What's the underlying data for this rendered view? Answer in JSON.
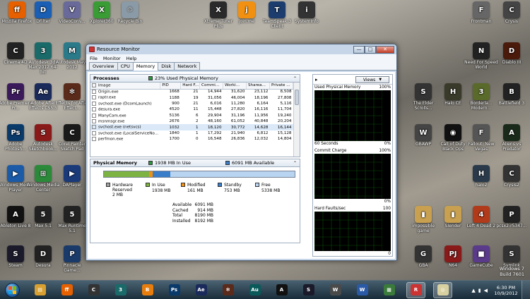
{
  "desktop_icons": [
    {
      "id": "firefox",
      "label": "Mozilla Firefox",
      "color": "#e66000",
      "glyph": "ff"
    },
    {
      "id": "dfilter",
      "label": "DFilter",
      "color": "#1a5fb4",
      "glyph": "D"
    },
    {
      "id": "videoconv",
      "label": "VideoConv...",
      "color": "#6a6a9a",
      "glyph": "V"
    },
    {
      "id": "xplorer",
      "label": "Xplorer360",
      "color": "#3a9c35",
      "glyph": "X"
    },
    {
      "id": "recyclebin",
      "label": "Recycle Bin",
      "color": "#8a9aa6",
      "glyph": "♲"
    },
    {
      "id": "xtreme",
      "label": "Xtreme Tuner Plus",
      "color": "#2a2a2a",
      "glyph": "X"
    },
    {
      "id": "joinme",
      "label": "join.me",
      "color": "#f29111",
      "glyph": "j"
    },
    {
      "id": "teamspeak",
      "label": "TeamSpeak 3 Client",
      "color": "#1d3d6e",
      "glyph": "T"
    },
    {
      "id": "sysinfo",
      "label": "SystemInfo",
      "color": "#333",
      "glyph": "i"
    },
    {
      "id": "frontman",
      "label": "Frontman",
      "color": "#666",
      "glyph": "F"
    },
    {
      "id": "crysis",
      "label": "Crysis",
      "color": "#444",
      "glyph": "C"
    },
    {
      "id": "cinema",
      "label": "Cinema 4D",
      "color": "#222",
      "glyph": "C"
    },
    {
      "id": "max",
      "label": "Autodesk 3ds Max 2012 64-bit",
      "color": "#1a6a6a",
      "glyph": "3"
    },
    {
      "id": "maya",
      "label": "Autodesk Maya 2012",
      "color": "#2a7a8a",
      "glyph": "M"
    },
    {
      "id": "premiere",
      "label": "Adobe Premiere Pr...",
      "color": "#3a1a5a",
      "glyph": "Pr"
    },
    {
      "id": "aftereffects",
      "label": "Adobe After Effects CS5.5",
      "color": "#1a2a5a",
      "glyph": "Ae"
    },
    {
      "id": "aeffects2",
      "label": "Effects for After Effect...",
      "color": "#5a2a1a",
      "glyph": "✻"
    },
    {
      "id": "photoshop",
      "label": "Adobe Photosh...",
      "color": "#0a3a6a",
      "glyph": "Ps"
    },
    {
      "id": "sketchbook",
      "label": "Autodesk Sketchbook...",
      "color": "#8a1a1a",
      "glyph": "S"
    },
    {
      "id": "corelpainter",
      "label": "Corel Painter Sketch Pad",
      "color": "#1a1a1a",
      "glyph": "C"
    },
    {
      "id": "wmp",
      "label": "Windows Media Player",
      "color": "#1a5aa6",
      "glyph": "▶"
    },
    {
      "id": "wmc",
      "label": "Windows Media Center",
      "color": "#2a8a3a",
      "glyph": "⊞"
    },
    {
      "id": "daplayer",
      "label": "DAPlayer",
      "color": "#1a3a7a",
      "glyph": "▶"
    },
    {
      "id": "ableton",
      "label": "Ableton Live 8",
      "color": "#111",
      "glyph": "A"
    },
    {
      "id": "max5",
      "label": "Max 5.1",
      "color": "#222",
      "glyph": "5"
    },
    {
      "id": "maxruntime",
      "label": "Max Runtime 5.1",
      "color": "#222",
      "glyph": "5"
    },
    {
      "id": "steam",
      "label": "Steam",
      "color": "#1a1a2a",
      "glyph": "S"
    },
    {
      "id": "desura",
      "label": "Desura",
      "color": "#222",
      "glyph": "D"
    },
    {
      "id": "pinnacle",
      "label": "Pinnacle Game...",
      "color": "#1a3a6a",
      "glyph": "P"
    },
    {
      "id": "nfs",
      "label": "Need For Speed World",
      "color": "#222",
      "glyph": "N"
    },
    {
      "id": "diablo",
      "label": "Diablo III",
      "color": "#4a1a0a",
      "glyph": "D"
    },
    {
      "id": "elderscrolls",
      "label": "The Elder Scrolls...",
      "color": "#333",
      "glyph": "S"
    },
    {
      "id": "halo",
      "label": "Halo CE",
      "color": "#3a3a2a",
      "glyph": "H"
    },
    {
      "id": "borderlands",
      "label": "Borderla... Modern...",
      "color": "#5a6a2a",
      "glyph": "3"
    },
    {
      "id": "battlefield",
      "label": "Battlefield 3",
      "color": "#222",
      "glyph": "B"
    },
    {
      "id": "gbawp",
      "label": "GBAWP",
      "color": "#444",
      "glyph": "W"
    },
    {
      "id": "codblackops",
      "label": "Call of Duty Black Ops",
      "color": "#111",
      "glyph": "◉"
    },
    {
      "id": "falloutnv",
      "label": "Fallout: New Vegas",
      "color": "#555",
      "glyph": "F"
    },
    {
      "id": "alienspred",
      "label": "Aliens vs Predator",
      "color": "#1a2a1a",
      "glyph": "A"
    },
    {
      "id": "halo2",
      "label": "halo2",
      "color": "#2a3a4a",
      "glyph": "H"
    },
    {
      "id": "crysis2",
      "label": "Crysis2",
      "color": "#333",
      "glyph": "C"
    },
    {
      "id": "impossible",
      "label": "impossible game",
      "color": "#c8a050",
      "glyph": "▮"
    },
    {
      "id": "slender",
      "label": "Slender",
      "color": "#c8a050",
      "glyph": "▮"
    },
    {
      "id": "l4d2",
      "label": "Left 4 Dead 2",
      "color": "#b03a1a",
      "glyph": "4"
    },
    {
      "id": "pcsx2",
      "label": "pcsx2-r5347...",
      "color": "#222",
      "glyph": "P"
    },
    {
      "id": "gba",
      "label": "GBA",
      "color": "#333",
      "glyph": "G"
    },
    {
      "id": "n64",
      "label": "N64",
      "color": "#8a1a1a",
      "glyph": "PJ"
    },
    {
      "id": "gamecube",
      "label": "GameCube",
      "color": "#5a3a8a",
      "glyph": "■"
    },
    {
      "id": "symlink",
      "label": "Symlink",
      "color": "#333",
      "glyph": "S"
    }
  ],
  "window": {
    "title": "Resource Monitor",
    "menu": [
      "File",
      "Monitor",
      "Help"
    ],
    "tabs": [
      "Overview",
      "CPU",
      "Memory",
      "Disk",
      "Network"
    ],
    "active_tab": "Memory",
    "win_buttons": {
      "minimize": "—",
      "maximize": "□",
      "close": "✕"
    }
  },
  "processes": {
    "title": "Processes",
    "summary": "23% Used Physical Memory",
    "columns": [
      "Image",
      "PID",
      "Hard F...",
      "Commi...",
      "Worki...",
      "Sharea...",
      "Private ..."
    ],
    "rows": [
      [
        "Origin.exe",
        "1668",
        "21",
        "14,944",
        "31,620",
        "23,112",
        "8,508"
      ],
      [
        "raptr.exe",
        "1188",
        "19",
        "31,056",
        "46,004",
        "18,196",
        "27,808"
      ],
      [
        "svchost.exe (DcomLaunch)",
        "900",
        "21",
        "6,016",
        "11,280",
        "6,164",
        "5,116"
      ],
      [
        "desura.exe",
        "4520",
        "11",
        "15,448",
        "27,820",
        "16,116",
        "11,704"
      ],
      [
        "ManyCam.exe",
        "5136",
        "6",
        "29,904",
        "31,196",
        "11,956",
        "19,240"
      ],
      [
        "msnmsgr.exe",
        "2676",
        "2",
        "48,160",
        "61,052",
        "40,848",
        "20,204"
      ],
      [
        "svchost.exe (netsvcs)",
        "1032",
        "1",
        "18,120",
        "30,772",
        "14,628",
        "16,144"
      ],
      [
        "svchost.exe (LocalServiceNo...",
        "1840",
        "1",
        "17,292",
        "21,940",
        "6,812",
        "15,128"
      ],
      [
        "perfmon.exe",
        "1700",
        "0",
        "16,548",
        "26,836",
        "12,032",
        "14,804"
      ]
    ],
    "selected_row": 6
  },
  "physical_memory": {
    "title": "Physical Memory",
    "in_use_head": "1938 MB In Use",
    "available_head": "6091 MB Available",
    "legend": [
      {
        "label": "Hardware Reserved",
        "value": "2 MB",
        "color": "#a0a0a0"
      },
      {
        "label": "In Use",
        "value": "1938 MB",
        "color": "#7cb342"
      },
      {
        "label": "Modified",
        "value": "161 MB",
        "color": "#f29111"
      },
      {
        "label": "Standby",
        "value": "753 MB",
        "color": "#3a7dc9"
      },
      {
        "label": "Free",
        "value": "5338 MB",
        "color": "#b8d4f0"
      }
    ],
    "bar_fractions": [
      0.0003,
      0.236,
      0.02,
      0.092,
      0.652
    ],
    "stats": [
      {
        "label": "Available",
        "value": "6091 MB"
      },
      {
        "label": "Cached",
        "value": "914 MB"
      },
      {
        "label": "Total",
        "value": "8190 MB"
      },
      {
        "label": "Installed",
        "value": "8192 MB"
      }
    ]
  },
  "graphs": {
    "views_label": "Views",
    "items": [
      {
        "title": "Used Physical Memory",
        "top": "100%",
        "bottom_left": "60 Seconds",
        "bottom_right": "0%"
      },
      {
        "title": "Commit Charge",
        "top": "100%",
        "bottom_left": "",
        "bottom_right": "0%"
      },
      {
        "title": "Hard Faults/sec",
        "top": "100",
        "bottom_left": "",
        "bottom_right": "0"
      }
    ]
  },
  "taskbar": {
    "apps": [
      {
        "id": "explorer",
        "color": "#d8a030",
        "glyph": "▤"
      },
      {
        "id": "firefox",
        "color": "#e66000",
        "glyph": "ff"
      },
      {
        "id": "cinema",
        "color": "#333",
        "glyph": "C"
      },
      {
        "id": "3dsmax",
        "color": "#1a6a6a",
        "glyph": "3"
      },
      {
        "id": "blender",
        "color": "#e87d0d",
        "glyph": "B"
      },
      {
        "id": "photoshop",
        "color": "#0a3a6a",
        "glyph": "Ps"
      },
      {
        "id": "aftereffects",
        "color": "#1a2a5a",
        "glyph": "Ae"
      },
      {
        "id": "tool",
        "color": "#5a2a1a",
        "glyph": "✻"
      },
      {
        "id": "audition",
        "color": "#0a5a5a",
        "glyph": "Au"
      },
      {
        "id": "ableton",
        "color": "#111",
        "glyph": "A"
      },
      {
        "id": "steam",
        "color": "#1a1a2a",
        "glyph": "S"
      },
      {
        "id": "wolf",
        "color": "#4a4a4a",
        "glyph": "W"
      },
      {
        "id": "word",
        "color": "#2a5aa6",
        "glyph": "W"
      },
      {
        "id": "paint",
        "color": "#3a7a3a",
        "glyph": "▦"
      },
      {
        "id": "resmon",
        "color": "#c33",
        "glyph": "R"
      },
      {
        "id": "chrome",
        "color": "#d8d0a0",
        "glyph": "◎"
      }
    ],
    "clock_time": "6:30 PM",
    "clock_date": "10/9/2012"
  },
  "watermark": {
    "line1": "Windows 7",
    "line2": "Build 7601"
  }
}
